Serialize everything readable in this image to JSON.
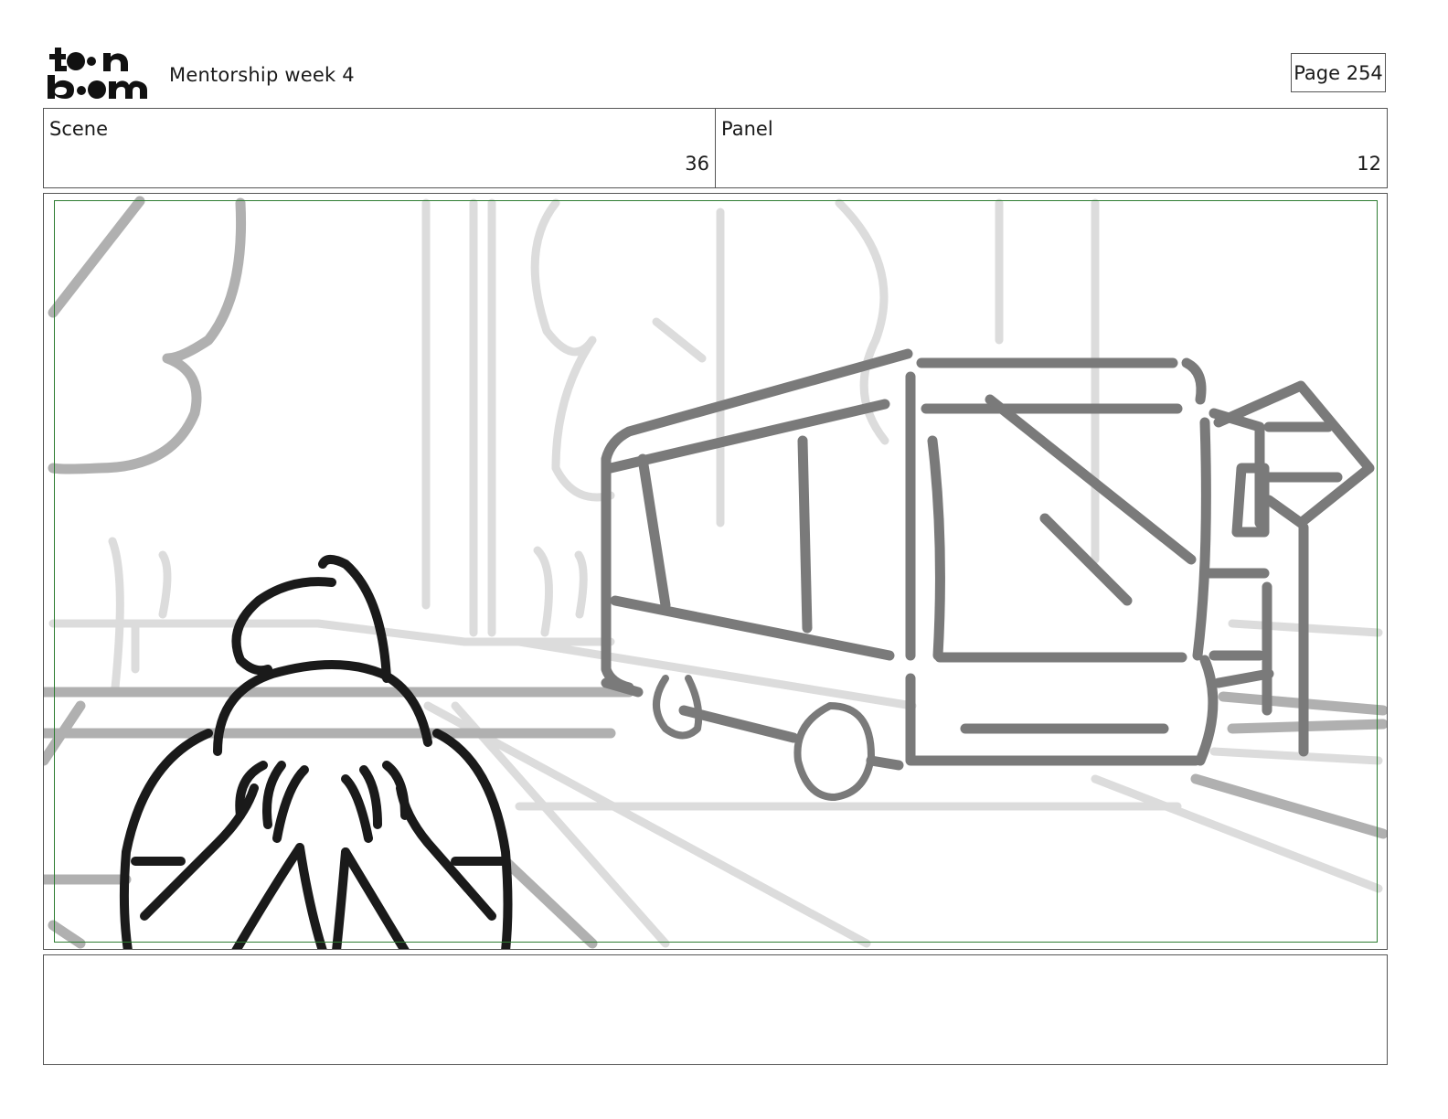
{
  "header": {
    "brand": "toon boom",
    "project_title": "Mentorship week 4",
    "page_label": "Page 254"
  },
  "scene": {
    "label": "Scene",
    "value": "36"
  },
  "panel": {
    "label": "Panel",
    "value": "12"
  },
  "notes": {
    "text": ""
  },
  "colors": {
    "frame_border": "#555555",
    "safe_frame": "#2e7d32",
    "sketch_dark": "#1a1a1a",
    "sketch_mid": "#7a7a7a",
    "sketch_light": "#d9d9d9"
  }
}
